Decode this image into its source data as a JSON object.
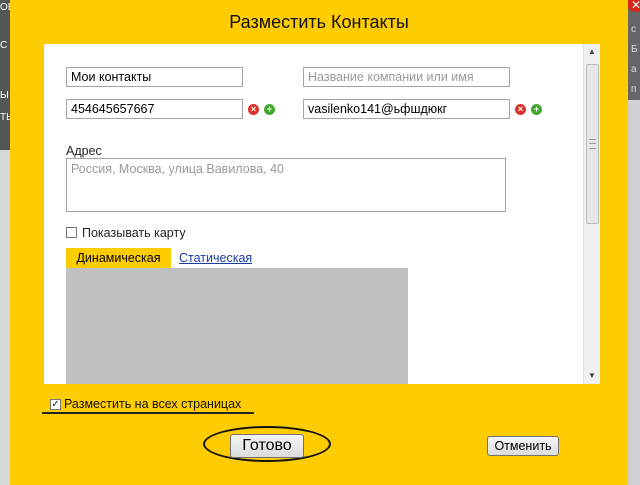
{
  "background": {
    "left_texts": [
      "ОВ",
      "С",
      "Ы",
      "ТЬ"
    ],
    "right_texts": [
      "с",
      "Б",
      "а",
      "п"
    ]
  },
  "dialog": {
    "title": "Разместить Контакты",
    "contacts_name": {
      "value": "Мои контакты",
      "placeholder": ""
    },
    "company_name": {
      "value": "",
      "placeholder": "Название компании или имя"
    },
    "phone": {
      "value": "454645657667"
    },
    "email": {
      "value": "vasilenko141@ьфшдюкг"
    },
    "address_label": "Адрес",
    "address": {
      "value": "",
      "placeholder": "Россия, Москва, улица Вавилова, 40"
    },
    "show_map": {
      "label": "Показывать карту",
      "checked": false
    },
    "map_tabs": [
      {
        "label": "Динамическая",
        "active": true
      },
      {
        "label": "Статическая",
        "active": false
      }
    ],
    "all_pages": {
      "label": "Разместить на всех страницах",
      "checked": true
    },
    "done_label": "Готово",
    "cancel_label": "Отменить"
  },
  "colors": {
    "dialog_background": "#ffcc00",
    "map_placeholder": "#c0c0c0",
    "link": "#1a3da6",
    "remove_icon": "#d9342b",
    "add_icon": "#44a830"
  }
}
